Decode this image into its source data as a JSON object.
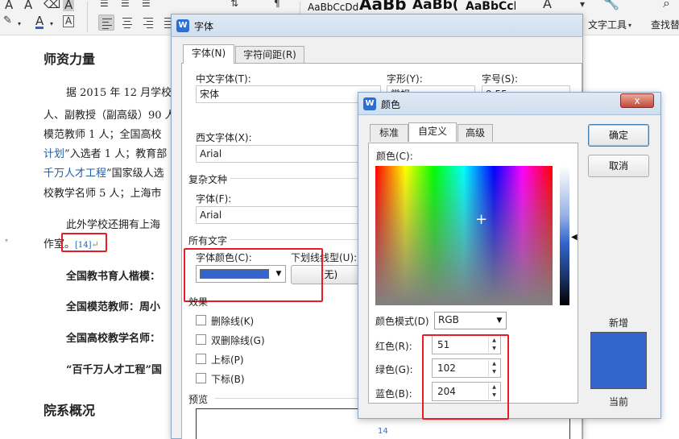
{
  "ribbon": {
    "style_previews": [
      "AaBbCcDd",
      "AaBb",
      "AaBb(",
      "AaBbCcI"
    ],
    "text_tool_label": "文字工具",
    "find_replace_label": "查找替"
  },
  "document": {
    "heading1": "师资力量",
    "para1": [
      "据 2015 年 12 月学校",
      "人、副教授（副高级）90 人",
      "模范教师 1 人；全国高校",
      "计划",
      "”入选者 1 人；教育部",
      "千万人才工程",
      "”国家级人选",
      "校教学名师 5 人；上海市"
    ],
    "para2_line1": "此外学校还拥有上海",
    "para2_line2": "作室。",
    "ref_mark": "[14]",
    "bold_items": [
      "全国教书育人楷模：",
      "全国模范教师：周小",
      "全国高校教学名师：",
      "“百千万人才工程”国"
    ],
    "heading2": "院系概况"
  },
  "font_dialog": {
    "title": "字体",
    "tabs": [
      {
        "label": "字体(N)"
      },
      {
        "label": "字符间距(R)"
      }
    ],
    "chinese_font_label": "中文字体(T):",
    "chinese_font_value": "宋体",
    "style_label": "字形(Y):",
    "style_value": "常规",
    "size_label": "字号(S):",
    "size_value": "9.55",
    "western_font_label": "西文字体(X):",
    "western_font_value": "Arial",
    "complex_section": "复杂文种",
    "complex_font_label": "字体(F):",
    "complex_font_value": "Arial",
    "all_text_section": "所有文字",
    "font_color_label": "字体颜色(C):",
    "font_color_hex": "#3366cc",
    "underline_label": "下划线线型(U):",
    "underline_value": "(无)",
    "effects_section": "效果",
    "effects": [
      "删除线(K)",
      "双删除线(G)",
      "上标(P)",
      "下标(B)"
    ],
    "preview_section": "预览"
  },
  "color_dialog": {
    "title": "颜色",
    "close_label": "x",
    "tabs": [
      {
        "label": "标准"
      },
      {
        "label": "自定义"
      },
      {
        "label": "高级"
      }
    ],
    "colors_label": "颜色(C):",
    "mode_label": "颜色模式(D)",
    "mode_value": "RGB",
    "red_label": "红色(R):",
    "red_value": "51",
    "green_label": "绿色(G):",
    "green_value": "102",
    "blue_label": "蓝色(B):",
    "blue_value": "204",
    "ok_label": "确定",
    "cancel_label": "取消",
    "new_label": "新增",
    "current_label": "当前",
    "swatch_hex": "#3366cc",
    "footer_text": "14"
  }
}
